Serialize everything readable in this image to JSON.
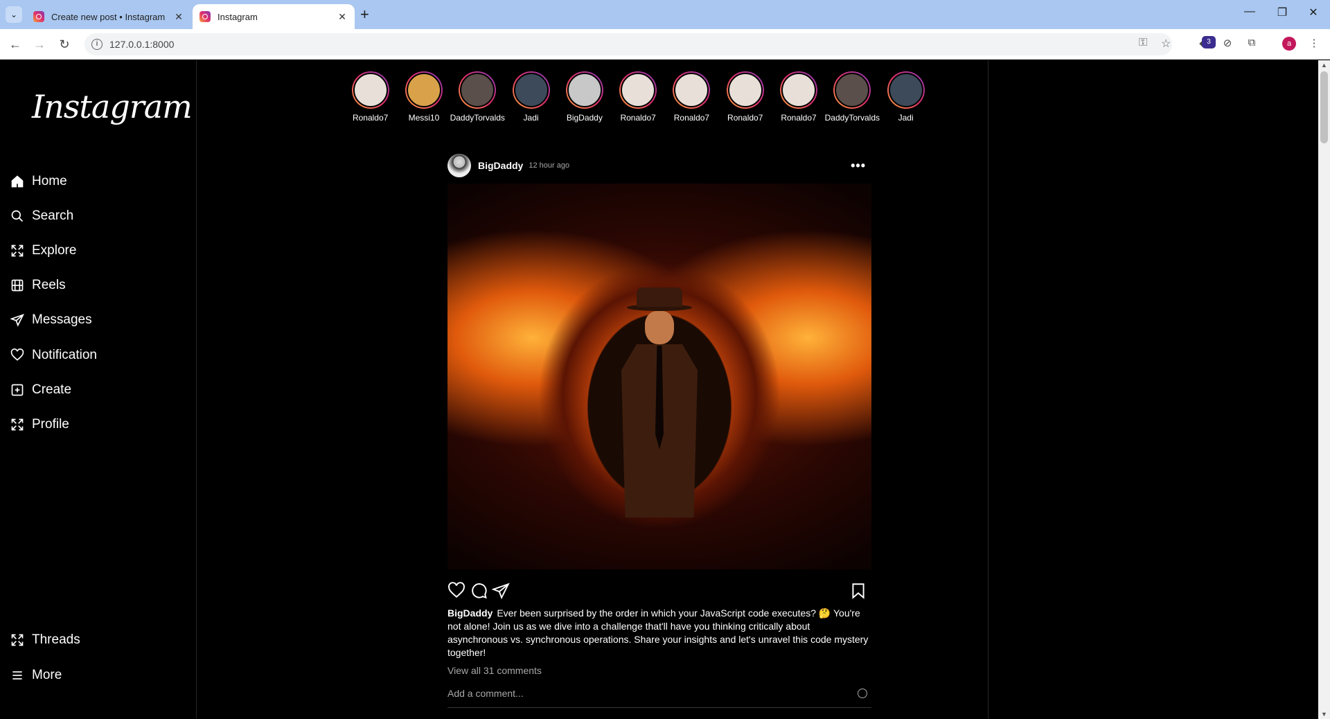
{
  "browser": {
    "tabs": [
      {
        "title": "Create new post • Instagram",
        "active": false
      },
      {
        "title": "Instagram",
        "active": true
      }
    ],
    "url": "127.0.0.1:8000",
    "extension_badge": "3",
    "profile_initial": "a"
  },
  "app": {
    "logo": "Instagram",
    "nav": [
      {
        "label": "Home",
        "icon": "home-icon"
      },
      {
        "label": "Search",
        "icon": "search-icon"
      },
      {
        "label": "Explore",
        "icon": "explore-icon"
      },
      {
        "label": "Reels",
        "icon": "reels-icon"
      },
      {
        "label": "Messages",
        "icon": "messages-icon"
      },
      {
        "label": "Notification",
        "icon": "heart-icon"
      },
      {
        "label": "Create",
        "icon": "create-icon"
      },
      {
        "label": "Profile",
        "icon": "profile-icon"
      }
    ],
    "nav_bottom": [
      {
        "label": "Threads",
        "icon": "threads-icon"
      },
      {
        "label": "More",
        "icon": "menu-icon"
      }
    ],
    "stories": [
      {
        "name": "Ronaldo7"
      },
      {
        "name": "Messi10"
      },
      {
        "name": "DaddyTorvalds"
      },
      {
        "name": "Jadi"
      },
      {
        "name": "BigDaddy"
      },
      {
        "name": "Ronaldo7"
      },
      {
        "name": "Ronaldo7"
      },
      {
        "name": "Ronaldo7"
      },
      {
        "name": "Ronaldo7"
      },
      {
        "name": "DaddyTorvalds"
      },
      {
        "name": "Jadi"
      }
    ],
    "post": {
      "username": "BigDaddy",
      "time": "12 hour ago",
      "more": "•••",
      "caption_user": "BigDaddy",
      "caption": "Ever been surprised by the order in which your JavaScript code executes? 🤔 You're not alone! Join us as we dive into a challenge that'll have you thinking critically about asynchronous vs. synchronous operations. Share your insights and let's unravel this code mystery together!",
      "view_comments": "View all 31 comments",
      "comment_placeholder": "Add a comment..."
    }
  }
}
